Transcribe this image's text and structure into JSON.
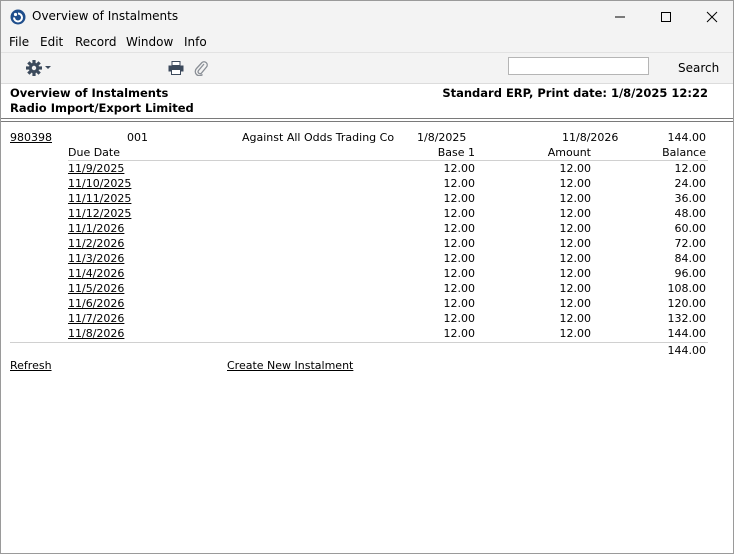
{
  "window": {
    "title": "Overview of Instalments"
  },
  "menu": {
    "items": [
      "File",
      "Edit",
      "Record",
      "Window",
      "Info"
    ]
  },
  "toolbar": {
    "search_value": "",
    "search_label": "Search"
  },
  "report": {
    "title": "Overview of Instalments",
    "company": "Radio Import/Export Limited",
    "system_info": "Standard ERP, Print date: 1/8/2025 12:22",
    "invoice": {
      "number": "980398",
      "code": "001",
      "customer": "Against All Odds Trading Co",
      "date": "1/8/2025",
      "due_date": "11/8/2026",
      "total": "144.00"
    },
    "columns": {
      "due_date": "Due Date",
      "base": "Base 1",
      "amount": "Amount",
      "balance": "Balance"
    },
    "rows": [
      {
        "due": "11/9/2025",
        "base": "12.00",
        "amount": "12.00",
        "balance": "12.00"
      },
      {
        "due": "11/10/2025",
        "base": "12.00",
        "amount": "12.00",
        "balance": "24.00"
      },
      {
        "due": "11/11/2025",
        "base": "12.00",
        "amount": "12.00",
        "balance": "36.00"
      },
      {
        "due": "11/12/2025",
        "base": "12.00",
        "amount": "12.00",
        "balance": "48.00"
      },
      {
        "due": "11/1/2026",
        "base": "12.00",
        "amount": "12.00",
        "balance": "60.00"
      },
      {
        "due": "11/2/2026",
        "base": "12.00",
        "amount": "12.00",
        "balance": "72.00"
      },
      {
        "due": "11/3/2026",
        "base": "12.00",
        "amount": "12.00",
        "balance": "84.00"
      },
      {
        "due": "11/4/2026",
        "base": "12.00",
        "amount": "12.00",
        "balance": "96.00"
      },
      {
        "due": "11/5/2026",
        "base": "12.00",
        "amount": "12.00",
        "balance": "108.00"
      },
      {
        "due": "11/6/2026",
        "base": "12.00",
        "amount": "12.00",
        "balance": "120.00"
      },
      {
        "due": "11/7/2026",
        "base": "12.00",
        "amount": "12.00",
        "balance": "132.00"
      },
      {
        "due": "11/8/2026",
        "base": "12.00",
        "amount": "12.00",
        "balance": "144.00"
      }
    ],
    "grand_total": "144.00",
    "actions": {
      "refresh": "Refresh",
      "create": "Create New Instalment"
    }
  },
  "colors": {
    "chrome_bg": "#f3f3f3",
    "accent_blue": "#1f4e8c"
  },
  "icons": {
    "app": "app-logo-icon",
    "minimize": "minimize-icon",
    "maximize": "maximize-icon",
    "close": "close-icon",
    "settings": "gear-icon",
    "print": "printer-icon",
    "attach": "paperclip-icon"
  }
}
